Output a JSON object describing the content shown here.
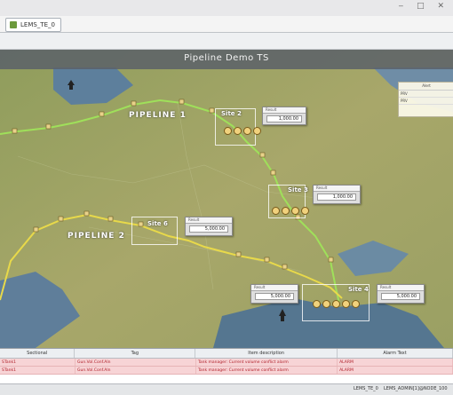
{
  "window": {
    "tab_title": "LEMS_TE_0"
  },
  "map": {
    "banner_title": "Pipeline Demo TS",
    "pipelines": [
      {
        "label": "PIPELINE 1"
      },
      {
        "label": "PIPELINE 2"
      }
    ],
    "sites": [
      {
        "label": "Site 2",
        "value": "1,000.00"
      },
      {
        "label": "Site 3",
        "value": "1,000.00"
      },
      {
        "label": "Site 6",
        "value": "5,000.00"
      },
      {
        "label": "Site 4",
        "value": "5,000.00"
      }
    ],
    "legend": {
      "header": "Alert",
      "rows": [
        "PRV",
        "PRV"
      ]
    }
  },
  "alarm_table": {
    "columns": [
      "Sectional",
      "Tag",
      "Item description",
      "Alarm Text"
    ],
    "rows": [
      [
        "STank1",
        "Gun.Vol.Conf.Aln",
        "Tank manager: Current volume conflict alarm",
        "ALARM"
      ],
      [
        "STank1",
        "Gun.Vol.Conf.Aln",
        "Tank manager: Current volume conflict alarm",
        "ALARM"
      ]
    ]
  },
  "status_bar": {
    "items": [
      "LEMS_TE_0",
      "LEMS_ADMIN[1]@NODE_100"
    ]
  },
  "colors": {
    "pipeline1": "#9fe05a",
    "pipeline2": "#e8d94a",
    "alarm_row": "#f7d4d6"
  }
}
